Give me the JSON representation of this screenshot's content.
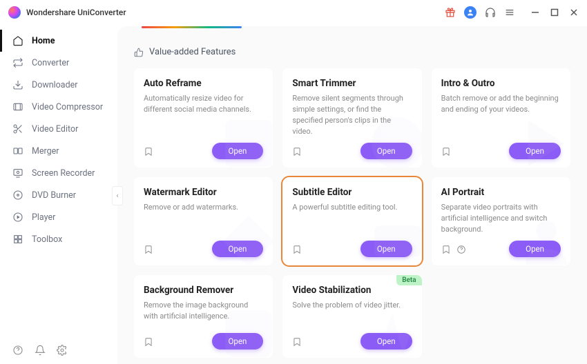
{
  "app": {
    "title": "Wondershare UniConverter"
  },
  "sidebar": {
    "items": [
      {
        "label": "Home"
      },
      {
        "label": "Converter"
      },
      {
        "label": "Downloader"
      },
      {
        "label": "Video Compressor"
      },
      {
        "label": "Video Editor"
      },
      {
        "label": "Merger"
      },
      {
        "label": "Screen Recorder"
      },
      {
        "label": "DVD Burner"
      },
      {
        "label": "Player"
      },
      {
        "label": "Toolbox"
      }
    ]
  },
  "section": {
    "title": "Value-added Features"
  },
  "buttons": {
    "open": "Open"
  },
  "badges": {
    "beta": "Beta"
  },
  "cards": [
    {
      "title": "Auto Reframe",
      "desc": "Automatically resize video for different social media channels."
    },
    {
      "title": "Smart Trimmer",
      "desc": "Remove silent segments through simple settings, or find the specified person's clips in the video."
    },
    {
      "title": "Intro & Outro",
      "desc": "Batch remove or add the beginning and ending of your videos."
    },
    {
      "title": "Watermark Editor",
      "desc": "Remove or add watermarks."
    },
    {
      "title": "Subtitle Editor",
      "desc": "A powerful subtitle editing tool."
    },
    {
      "title": "AI Portrait",
      "desc": "Separate video portraits with artificial intelligence and switch background."
    },
    {
      "title": "Background Remover",
      "desc": "Remove the image background with artificial intelligence."
    },
    {
      "title": "Video Stabilization",
      "desc": "Solve the problem of video jitter."
    }
  ],
  "colors": {
    "accent": "#8b5cf6",
    "highlight": "#e8873a"
  }
}
